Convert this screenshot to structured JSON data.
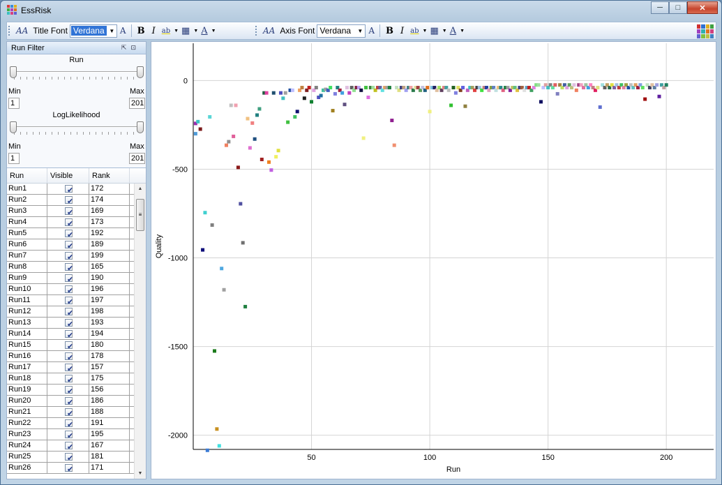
{
  "window": {
    "title": "EssRisk"
  },
  "toolbar": {
    "title_font_label": "Title Font",
    "title_font_value": "Verdana",
    "axis_font_label": "Axis Font",
    "axis_font_value": "Verdana",
    "bold_label": "B",
    "italic_label": "I",
    "font_size_icon_label": "A",
    "highlight_icon_label": "ab",
    "font_color_icon_label": "A"
  },
  "run_filter": {
    "header": "Run Filter",
    "run_slider": {
      "title": "Run",
      "min_label": "Min",
      "max_label": "Max",
      "min_value": "1",
      "max_value": "201"
    },
    "loglik_slider": {
      "title": "LogLikelihood",
      "min_label": "Min",
      "max_label": "Max",
      "min_value": "1",
      "max_value": "201"
    }
  },
  "run_table": {
    "columns": [
      "Run",
      "Visible",
      "Rank"
    ],
    "rows": [
      {
        "run": "Run1",
        "visible": true,
        "rank": "172"
      },
      {
        "run": "Run2",
        "visible": true,
        "rank": "174"
      },
      {
        "run": "Run3",
        "visible": true,
        "rank": "169"
      },
      {
        "run": "Run4",
        "visible": true,
        "rank": "173"
      },
      {
        "run": "Run5",
        "visible": true,
        "rank": "192"
      },
      {
        "run": "Run6",
        "visible": true,
        "rank": "189"
      },
      {
        "run": "Run7",
        "visible": true,
        "rank": "199"
      },
      {
        "run": "Run8",
        "visible": true,
        "rank": "165"
      },
      {
        "run": "Run9",
        "visible": true,
        "rank": "190"
      },
      {
        "run": "Run10",
        "visible": true,
        "rank": "196"
      },
      {
        "run": "Run11",
        "visible": true,
        "rank": "197"
      },
      {
        "run": "Run12",
        "visible": true,
        "rank": "198"
      },
      {
        "run": "Run13",
        "visible": true,
        "rank": "193"
      },
      {
        "run": "Run14",
        "visible": true,
        "rank": "194"
      },
      {
        "run": "Run15",
        "visible": true,
        "rank": "180"
      },
      {
        "run": "Run16",
        "visible": true,
        "rank": "178"
      },
      {
        "run": "Run17",
        "visible": true,
        "rank": "157"
      },
      {
        "run": "Run18",
        "visible": true,
        "rank": "175"
      },
      {
        "run": "Run19",
        "visible": true,
        "rank": "156"
      },
      {
        "run": "Run20",
        "visible": true,
        "rank": "186"
      },
      {
        "run": "Run21",
        "visible": true,
        "rank": "188"
      },
      {
        "run": "Run22",
        "visible": true,
        "rank": "191"
      },
      {
        "run": "Run23",
        "visible": true,
        "rank": "195"
      },
      {
        "run": "Run24",
        "visible": true,
        "rank": "167"
      },
      {
        "run": "Run25",
        "visible": true,
        "rank": "181"
      },
      {
        "run": "Run26",
        "visible": true,
        "rank": "171"
      }
    ]
  },
  "chart_data": {
    "type": "scatter",
    "xlabel": "Run",
    "ylabel": "Quality",
    "xlim": [
      0,
      220
    ],
    "ylim": [
      -2080,
      210
    ],
    "xticks": [
      50,
      100,
      150,
      200
    ],
    "yticks": [
      0,
      -500,
      -1000,
      -1500,
      -2000
    ],
    "grid": true,
    "points": [
      {
        "x": 1,
        "y": -242,
        "color": "#9b2fae"
      },
      {
        "x": 1,
        "y": -300,
        "color": "#4f9bd8"
      },
      {
        "x": 2,
        "y": -232,
        "color": "#3cc4c4"
      },
      {
        "x": 3,
        "y": -274,
        "color": "#7b1a1a"
      },
      {
        "x": 4,
        "y": -955,
        "color": "#0e0e7a"
      },
      {
        "x": 5,
        "y": -745,
        "color": "#40d0d0"
      },
      {
        "x": 6,
        "y": -2085,
        "color": "#3a7bd5"
      },
      {
        "x": 7,
        "y": -205,
        "color": "#5ad6d6"
      },
      {
        "x": 8,
        "y": -815,
        "color": "#808080"
      },
      {
        "x": 9,
        "y": -1525,
        "color": "#1a7a1a"
      },
      {
        "x": 10,
        "y": -1965,
        "color": "#c89020"
      },
      {
        "x": 11,
        "y": -2060,
        "color": "#40e0e0"
      },
      {
        "x": 12,
        "y": -1060,
        "color": "#4fa8e0"
      },
      {
        "x": 13,
        "y": -1180,
        "color": "#a0a0a0"
      },
      {
        "x": 14,
        "y": -365,
        "color": "#f08060"
      },
      {
        "x": 15,
        "y": -345,
        "color": "#909090"
      },
      {
        "x": 16,
        "y": -140,
        "color": "#c0c0c0"
      },
      {
        "x": 17,
        "y": -315,
        "color": "#e0609a"
      },
      {
        "x": 18,
        "y": -140,
        "color": "#f0a0b0"
      },
      {
        "x": 19,
        "y": -490,
        "color": "#8b1a1a"
      },
      {
        "x": 20,
        "y": -695,
        "color": "#5050a0"
      },
      {
        "x": 21,
        "y": -915,
        "color": "#707070"
      },
      {
        "x": 22,
        "y": -1275,
        "color": "#208040"
      },
      {
        "x": 23,
        "y": -215,
        "color": "#f0c080"
      },
      {
        "x": 24,
        "y": -380,
        "color": "#e070d0"
      },
      {
        "x": 25,
        "y": -240,
        "color": "#f08080"
      },
      {
        "x": 26,
        "y": -330,
        "color": "#205080"
      },
      {
        "x": 27,
        "y": -195,
        "color": "#208080"
      },
      {
        "x": 28,
        "y": -160,
        "color": "#40a080"
      },
      {
        "x": 29,
        "y": -445,
        "color": "#a02020"
      },
      {
        "x": 30,
        "y": -70,
        "color": "#206040"
      },
      {
        "x": 31,
        "y": -70,
        "color": "#e040a0"
      },
      {
        "x": 32,
        "y": -460,
        "color": "#f08020"
      },
      {
        "x": 33,
        "y": -505,
        "color": "#c060e0"
      },
      {
        "x": 34,
        "y": -70,
        "color": "#205070"
      },
      {
        "x": 35,
        "y": -430,
        "color": "#f0f060"
      },
      {
        "x": 36,
        "y": -395,
        "color": "#e0e040"
      },
      {
        "x": 37,
        "y": -70,
        "color": "#5050c0"
      },
      {
        "x": 38,
        "y": -100,
        "color": "#40c0c0"
      },
      {
        "x": 39,
        "y": -70,
        "color": "#a0a0a0"
      },
      {
        "x": 40,
        "y": -235,
        "color": "#40c040"
      },
      {
        "x": 41,
        "y": -55,
        "color": "#2050a0"
      },
      {
        "x": 42,
        "y": -55,
        "color": "#c0c0ff"
      },
      {
        "x": 43,
        "y": -205,
        "color": "#40c060"
      },
      {
        "x": 44,
        "y": -175,
        "color": "#101070"
      },
      {
        "x": 45,
        "y": -55,
        "color": "#f0a060"
      },
      {
        "x": 46,
        "y": -40,
        "color": "#c08040"
      },
      {
        "x": 47,
        "y": -100,
        "color": "#202020"
      },
      {
        "x": 48,
        "y": -55,
        "color": "#802020"
      },
      {
        "x": 49,
        "y": -40,
        "color": "#c02020"
      },
      {
        "x": 50,
        "y": -120,
        "color": "#108030"
      },
      {
        "x": 51,
        "y": -55,
        "color": "#e0a0e0"
      },
      {
        "x": 52,
        "y": -40,
        "color": "#808080"
      },
      {
        "x": 53,
        "y": -95,
        "color": "#5050c0"
      },
      {
        "x": 54,
        "y": -85,
        "color": "#2070a0"
      },
      {
        "x": 55,
        "y": -55,
        "color": "#40c0a0"
      },
      {
        "x": 56,
        "y": -50,
        "color": "#a0a0a0"
      },
      {
        "x": 57,
        "y": -55,
        "color": "#4060c0"
      },
      {
        "x": 58,
        "y": -40,
        "color": "#40e060"
      },
      {
        "x": 59,
        "y": -170,
        "color": "#a08020"
      },
      {
        "x": 60,
        "y": -75,
        "color": "#8080e0"
      },
      {
        "x": 61,
        "y": -40,
        "color": "#208080"
      },
      {
        "x": 62,
        "y": -55,
        "color": "#a02040"
      },
      {
        "x": 63,
        "y": -70,
        "color": "#40a0e0"
      },
      {
        "x": 64,
        "y": -135,
        "color": "#605080"
      },
      {
        "x": 65,
        "y": -40,
        "color": "#e0c0e0"
      },
      {
        "x": 66,
        "y": -70,
        "color": "#c040c0"
      },
      {
        "x": 67,
        "y": -40,
        "color": "#606060"
      },
      {
        "x": 68,
        "y": -55,
        "color": "#90e090"
      },
      {
        "x": 69,
        "y": -40,
        "color": "#802040"
      },
      {
        "x": 70,
        "y": -40,
        "color": "#c0a0f0"
      },
      {
        "x": 71,
        "y": -55,
        "color": "#101040"
      },
      {
        "x": 72,
        "y": -325,
        "color": "#f0f080"
      },
      {
        "x": 73,
        "y": -40,
        "color": "#40c040"
      },
      {
        "x": 74,
        "y": -95,
        "color": "#e070e0"
      },
      {
        "x": 75,
        "y": -40,
        "color": "#408040"
      },
      {
        "x": 76,
        "y": -40,
        "color": "#a0e0a0"
      },
      {
        "x": 77,
        "y": -55,
        "color": "#c0c020"
      },
      {
        "x": 78,
        "y": -40,
        "color": "#c04040"
      },
      {
        "x": 79,
        "y": -40,
        "color": "#6060a0"
      },
      {
        "x": 80,
        "y": -55,
        "color": "#60e0e0"
      },
      {
        "x": 81,
        "y": -40,
        "color": "#e0a060"
      },
      {
        "x": 82,
        "y": -40,
        "color": "#a0a0a0"
      },
      {
        "x": 83,
        "y": -40,
        "color": "#208040"
      },
      {
        "x": 84,
        "y": -225,
        "color": "#902090"
      },
      {
        "x": 85,
        "y": -365,
        "color": "#f09070"
      },
      {
        "x": 86,
        "y": -40,
        "color": "#c0e0c0"
      },
      {
        "x": 87,
        "y": -55,
        "color": "#e0e080"
      },
      {
        "x": 88,
        "y": -40,
        "color": "#404080"
      },
      {
        "x": 89,
        "y": -40,
        "color": "#c0a080"
      },
      {
        "x": 90,
        "y": -55,
        "color": "#a0a0f0"
      },
      {
        "x": 91,
        "y": -40,
        "color": "#408080"
      },
      {
        "x": 92,
        "y": -40,
        "color": "#f0a0a0"
      },
      {
        "x": 93,
        "y": -55,
        "color": "#2a7a4a"
      },
      {
        "x": 94,
        "y": -40,
        "color": "#e0e0a0"
      },
      {
        "x": 95,
        "y": -40,
        "color": "#a04040"
      },
      {
        "x": 96,
        "y": -55,
        "color": "#60a060"
      },
      {
        "x": 97,
        "y": -40,
        "color": "#c0c0e0"
      },
      {
        "x": 98,
        "y": -55,
        "color": "#206080"
      },
      {
        "x": 99,
        "y": -40,
        "color": "#e07020"
      },
      {
        "x": 100,
        "y": -175,
        "color": "#f0f080"
      },
      {
        "x": 101,
        "y": -40,
        "color": "#80c0e0"
      },
      {
        "x": 102,
        "y": -40,
        "color": "#202060"
      },
      {
        "x": 103,
        "y": -55,
        "color": "#e0c0a0"
      },
      {
        "x": 104,
        "y": -40,
        "color": "#a0e060"
      },
      {
        "x": 105,
        "y": -55,
        "color": "#604060"
      },
      {
        "x": 106,
        "y": -40,
        "color": "#e08080"
      },
      {
        "x": 107,
        "y": -40,
        "color": "#40a0a0"
      },
      {
        "x": 108,
        "y": -55,
        "color": "#c0c0c0"
      },
      {
        "x": 109,
        "y": -140,
        "color": "#30c030"
      },
      {
        "x": 110,
        "y": -40,
        "color": "#206020"
      },
      {
        "x": 111,
        "y": -70,
        "color": "#8080e0"
      },
      {
        "x": 112,
        "y": -40,
        "color": "#e0e060"
      },
      {
        "x": 113,
        "y": -55,
        "color": "#804020"
      },
      {
        "x": 114,
        "y": -40,
        "color": "#6060e0"
      },
      {
        "x": 115,
        "y": -145,
        "color": "#908040"
      },
      {
        "x": 116,
        "y": -55,
        "color": "#c060c0"
      },
      {
        "x": 117,
        "y": -40,
        "color": "#40c0c0"
      },
      {
        "x": 118,
        "y": -40,
        "color": "#a0a060"
      },
      {
        "x": 119,
        "y": -55,
        "color": "#e04040"
      },
      {
        "x": 120,
        "y": -40,
        "color": "#404040"
      },
      {
        "x": 121,
        "y": -40,
        "color": "#a0c0e0"
      },
      {
        "x": 122,
        "y": -55,
        "color": "#40e040"
      },
      {
        "x": 123,
        "y": -40,
        "color": "#c08080"
      },
      {
        "x": 124,
        "y": -40,
        "color": "#2040a0"
      },
      {
        "x": 125,
        "y": -55,
        "color": "#e0a0c0"
      },
      {
        "x": 126,
        "y": -40,
        "color": "#80a040"
      },
      {
        "x": 127,
        "y": -40,
        "color": "#6080c0"
      },
      {
        "x": 128,
        "y": -55,
        "color": "#c0e0e0"
      },
      {
        "x": 129,
        "y": -40,
        "color": "#f0c080"
      },
      {
        "x": 130,
        "y": -40,
        "color": "#2a8a8a"
      },
      {
        "x": 131,
        "y": -55,
        "color": "#e06080"
      },
      {
        "x": 132,
        "y": -40,
        "color": "#208040"
      },
      {
        "x": 133,
        "y": -40,
        "color": "#a0a0a0"
      },
      {
        "x": 134,
        "y": -55,
        "color": "#8020a0"
      },
      {
        "x": 135,
        "y": -40,
        "color": "#c0c060"
      },
      {
        "x": 136,
        "y": -40,
        "color": "#60c080"
      },
      {
        "x": 137,
        "y": -55,
        "color": "#e0c040"
      },
      {
        "x": 138,
        "y": -40,
        "color": "#404080"
      },
      {
        "x": 139,
        "y": -40,
        "color": "#a06040"
      },
      {
        "x": 140,
        "y": -55,
        "color": "#e0e0e0"
      },
      {
        "x": 141,
        "y": -40,
        "color": "#60a0c0"
      },
      {
        "x": 142,
        "y": -40,
        "color": "#c02020"
      },
      {
        "x": 143,
        "y": -55,
        "color": "#40a060"
      },
      {
        "x": 144,
        "y": -40,
        "color": "#e080e0"
      },
      {
        "x": 145,
        "y": -25,
        "color": "#80e080"
      },
      {
        "x": 146,
        "y": -25,
        "color": "#a0e0a0"
      },
      {
        "x": 147,
        "y": -120,
        "color": "#101060"
      },
      {
        "x": 148,
        "y": -40,
        "color": "#c0c0ff"
      },
      {
        "x": 149,
        "y": -25,
        "color": "#e0a0a0"
      },
      {
        "x": 150,
        "y": -40,
        "color": "#40c0c0"
      },
      {
        "x": 151,
        "y": -25,
        "color": "#808080"
      },
      {
        "x": 152,
        "y": -40,
        "color": "#60e0a0"
      },
      {
        "x": 153,
        "y": -25,
        "color": "#e06060"
      },
      {
        "x": 154,
        "y": -75,
        "color": "#8080c0"
      },
      {
        "x": 155,
        "y": -25,
        "color": "#a08040"
      },
      {
        "x": 156,
        "y": -40,
        "color": "#c0e060"
      },
      {
        "x": 157,
        "y": -25,
        "color": "#4060a0"
      },
      {
        "x": 158,
        "y": -40,
        "color": "#e0a0e0"
      },
      {
        "x": 159,
        "y": -25,
        "color": "#60a060"
      },
      {
        "x": 160,
        "y": -40,
        "color": "#c0c080"
      },
      {
        "x": 161,
        "y": -25,
        "color": "#e0c0e0"
      },
      {
        "x": 162,
        "y": -55,
        "color": "#f08060"
      },
      {
        "x": 163,
        "y": -25,
        "color": "#a04080"
      },
      {
        "x": 164,
        "y": -25,
        "color": "#f0a0c0"
      },
      {
        "x": 165,
        "y": -40,
        "color": "#e070a0"
      },
      {
        "x": 166,
        "y": -25,
        "color": "#a0c0a0"
      },
      {
        "x": 167,
        "y": -40,
        "color": "#40a0e0"
      },
      {
        "x": 168,
        "y": -25,
        "color": "#ff80c0"
      },
      {
        "x": 169,
        "y": -40,
        "color": "#c08080"
      },
      {
        "x": 170,
        "y": -55,
        "color": "#e02060"
      },
      {
        "x": 171,
        "y": -40,
        "color": "#e0e080"
      },
      {
        "x": 172,
        "y": -150,
        "color": "#6070d0"
      },
      {
        "x": 173,
        "y": -25,
        "color": "#a0e0e0"
      },
      {
        "x": 174,
        "y": -40,
        "color": "#606060"
      },
      {
        "x": 175,
        "y": -25,
        "color": "#c0a060"
      },
      {
        "x": 176,
        "y": -40,
        "color": "#2a6a4a"
      },
      {
        "x": 177,
        "y": -25,
        "color": "#e0e040"
      },
      {
        "x": 178,
        "y": -40,
        "color": "#8060a0"
      },
      {
        "x": 179,
        "y": -25,
        "color": "#a0c0e0"
      },
      {
        "x": 180,
        "y": -40,
        "color": "#c04040"
      },
      {
        "x": 181,
        "y": -25,
        "color": "#40c060"
      },
      {
        "x": 182,
        "y": -40,
        "color": "#e080a0"
      },
      {
        "x": 183,
        "y": -25,
        "color": "#a0a040"
      },
      {
        "x": 184,
        "y": -40,
        "color": "#2050a0"
      },
      {
        "x": 185,
        "y": -25,
        "color": "#c0c0c0"
      },
      {
        "x": 186,
        "y": -40,
        "color": "#60c0c0"
      },
      {
        "x": 187,
        "y": -25,
        "color": "#e0a060"
      },
      {
        "x": 188,
        "y": -40,
        "color": "#a02040"
      },
      {
        "x": 189,
        "y": -25,
        "color": "#80a0e0"
      },
      {
        "x": 190,
        "y": -40,
        "color": "#60e060"
      },
      {
        "x": 191,
        "y": -105,
        "color": "#a01010"
      },
      {
        "x": 192,
        "y": -25,
        "color": "#c0e0c0"
      },
      {
        "x": 193,
        "y": -40,
        "color": "#404060"
      },
      {
        "x": 194,
        "y": -25,
        "color": "#e0c0a0"
      },
      {
        "x": 195,
        "y": -40,
        "color": "#6080a0"
      },
      {
        "x": 196,
        "y": -25,
        "color": "#a0a0e0"
      },
      {
        "x": 197,
        "y": -90,
        "color": "#6020a0"
      },
      {
        "x": 198,
        "y": -25,
        "color": "#40a0a0"
      },
      {
        "x": 199,
        "y": -40,
        "color": "#c0a0a0"
      },
      {
        "x": 200,
        "y": -25,
        "color": "#208060"
      }
    ]
  }
}
